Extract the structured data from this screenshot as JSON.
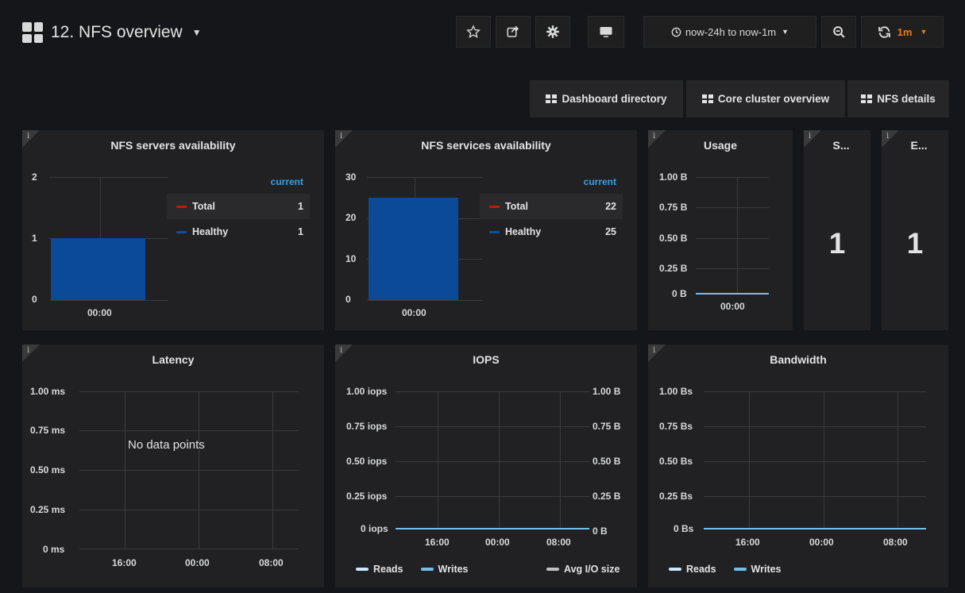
{
  "header": {
    "title": "12. NFS overview",
    "time_range": "now-24h to now-1m",
    "refresh_interval": "1m"
  },
  "links": [
    {
      "label": "Dashboard directory"
    },
    {
      "label": "Core cluster overview"
    },
    {
      "label": "NFS details"
    }
  ],
  "colors": {
    "total": "#bf1b00",
    "healthy": "#0a50a1",
    "reads": "#c8e8ff",
    "writes": "#73bfea",
    "avg": "#c0c0c0",
    "accent": "#eb7b18",
    "legend_header": "#33a2e5"
  },
  "panels": {
    "servers": {
      "title": "NFS servers availability",
      "legend_header": "current",
      "legend": [
        {
          "name": "Total",
          "value": "1"
        },
        {
          "name": "Healthy",
          "value": "1"
        }
      ],
      "y_ticks": [
        "2",
        "1",
        "0"
      ],
      "x_ticks": [
        "00:00"
      ]
    },
    "services": {
      "title": "NFS services availability",
      "legend_header": "current",
      "legend": [
        {
          "name": "Total",
          "value": "22"
        },
        {
          "name": "Healthy",
          "value": "25"
        }
      ],
      "y_ticks": [
        "30",
        "20",
        "10",
        "0"
      ],
      "x_ticks": [
        "00:00"
      ]
    },
    "usage": {
      "title": "Usage",
      "y_ticks": [
        "1.00 B",
        "0.75 B",
        "0.50 B",
        "0.25 B",
        "0 B"
      ],
      "x_ticks": [
        "00:00"
      ]
    },
    "stat1": {
      "title": "S...",
      "value": "1"
    },
    "stat2": {
      "title": "E...",
      "value": "1"
    },
    "latency": {
      "title": "Latency",
      "no_data": "No data points",
      "y_ticks": [
        "1.00 ms",
        "0.75 ms",
        "0.50 ms",
        "0.25 ms",
        "0 ms"
      ],
      "x_ticks": [
        "16:00",
        "00:00",
        "08:00"
      ]
    },
    "iops": {
      "title": "IOPS",
      "y_ticks": [
        "1.00 iops",
        "0.75 iops",
        "0.50 iops",
        "0.25 iops",
        "0 iops"
      ],
      "y2_ticks": [
        "1.00 B",
        "0.75 B",
        "0.50 B",
        "0.25 B",
        "0 B"
      ],
      "x_ticks": [
        "16:00",
        "00:00",
        "08:00"
      ],
      "legend": {
        "reads": "Reads",
        "writes": "Writes",
        "avg": "Avg I/O size"
      }
    },
    "bandwidth": {
      "title": "Bandwidth",
      "y_ticks": [
        "1.00 Bs",
        "0.75 Bs",
        "0.50 Bs",
        "0.25 Bs",
        "0 Bs"
      ],
      "x_ticks": [
        "16:00",
        "00:00",
        "08:00"
      ],
      "legend": {
        "reads": "Reads",
        "writes": "Writes"
      }
    }
  },
  "chart_data": [
    {
      "type": "bar",
      "title": "NFS servers availability",
      "categories": [
        "00:00"
      ],
      "series": [
        {
          "name": "Total",
          "values": [
            1
          ]
        },
        {
          "name": "Healthy",
          "values": [
            1
          ]
        }
      ],
      "ylim": [
        0,
        2
      ]
    },
    {
      "type": "bar",
      "title": "NFS services availability",
      "categories": [
        "00:00"
      ],
      "series": [
        {
          "name": "Total",
          "values": [
            22
          ]
        },
        {
          "name": "Healthy",
          "values": [
            25
          ]
        }
      ],
      "ylim": [
        0,
        30
      ]
    },
    {
      "type": "line",
      "title": "Usage",
      "x": [
        "00:00"
      ],
      "series": [
        {
          "values": [
            0
          ]
        }
      ],
      "ylim": [
        0,
        1
      ]
    },
    {
      "type": "line",
      "title": "IOPS",
      "x": [
        "16:00",
        "00:00",
        "08:00"
      ],
      "series": [
        {
          "name": "Reads",
          "values": [
            0,
            0,
            0
          ]
        },
        {
          "name": "Writes",
          "values": [
            0,
            0,
            0
          ]
        },
        {
          "name": "Avg I/O size",
          "values": [
            0,
            0,
            0
          ]
        }
      ],
      "ylim": [
        0,
        1
      ]
    },
    {
      "type": "line",
      "title": "Bandwidth",
      "x": [
        "16:00",
        "00:00",
        "08:00"
      ],
      "series": [
        {
          "name": "Reads",
          "values": [
            0,
            0,
            0
          ]
        },
        {
          "name": "Writes",
          "values": [
            0,
            0,
            0
          ]
        }
      ],
      "ylim": [
        0,
        1
      ]
    }
  ]
}
